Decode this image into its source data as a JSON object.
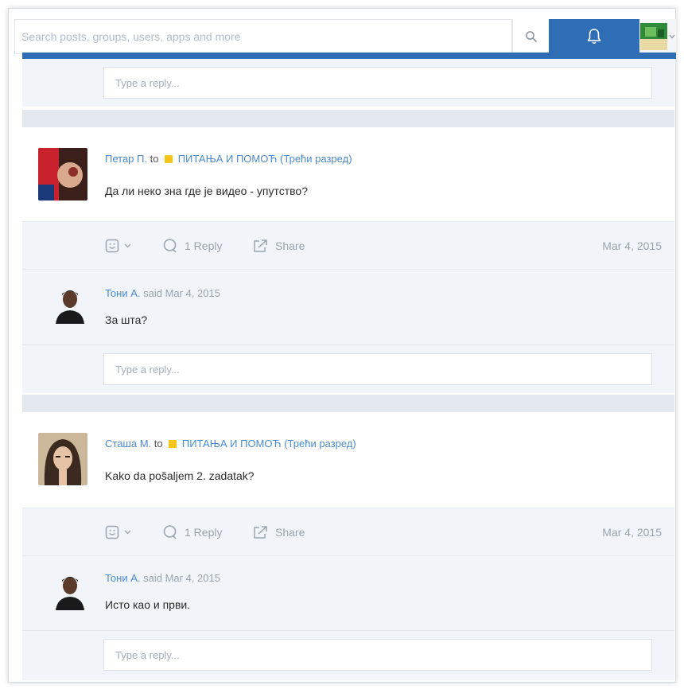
{
  "search": {
    "placeholder": "Search posts, groups, users, apps and more"
  },
  "icons": {
    "search": "search-icon",
    "bell": "bell-icon",
    "user_avatar": "user-avatar",
    "caret": "chevron-down-icon",
    "emoji": "emoji-icon",
    "reply": "comment-icon",
    "share": "share-icon"
  },
  "colors": {
    "brand": "#2f6db5",
    "link": "#4a8ad0",
    "group_square": "#f5c518",
    "panel": "#f1f5f9"
  },
  "top_reply": {
    "placeholder": "Type a reply..."
  },
  "posts": [
    {
      "author": "Петар П.",
      "to_label": "to",
      "group": "ПИТАЊА И ПОМОЋ (Трећи разред)",
      "body": "Да ли неко зна где је видео - упутство?",
      "reply_count": "1 Reply",
      "share_label": "Share",
      "date": "Mar 4, 2015",
      "comment": {
        "author": "Тони А.",
        "said": "said Mar 4, 2015",
        "body": "За шта?"
      },
      "reply_placeholder": "Type a reply..."
    },
    {
      "author": "Сташа М.",
      "to_label": "to",
      "group": "ПИТАЊА И ПОМОЋ (Трећи разред)",
      "body": "Kako da pošaljem 2. zadatak?",
      "reply_count": "1 Reply",
      "share_label": "Share",
      "date": "Mar 4, 2015",
      "comment": {
        "author": "Тони А.",
        "said": "said Mar 4, 2015",
        "body": "Исто као и први."
      },
      "reply_placeholder": "Type a reply..."
    }
  ]
}
